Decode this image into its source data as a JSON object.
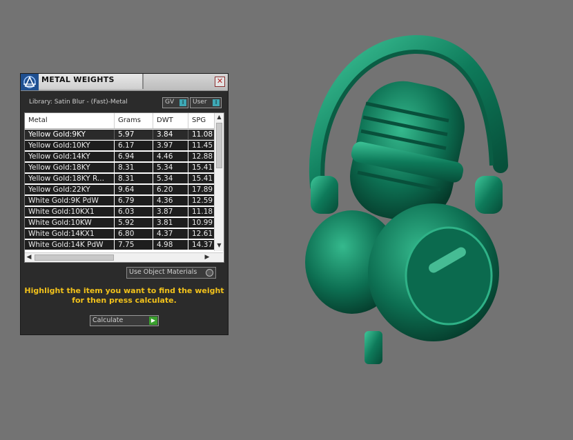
{
  "panel": {
    "title": "METAL WEIGHTS",
    "library": "Library: Satin Blur - (Fast)-Metal",
    "toggle_gv": "GV",
    "toggle_user": "User",
    "table": {
      "headers": [
        "Metal",
        "Grams",
        "DWT",
        "SPG"
      ],
      "rows": [
        [
          "Yellow Gold:9KY",
          "5.97",
          "3.84",
          "11.08"
        ],
        [
          "Yellow Gold:10KY",
          "6.17",
          "3.97",
          "11.45"
        ],
        [
          "Yellow Gold:14KY",
          "6.94",
          "4.46",
          "12.88"
        ],
        [
          "Yellow Gold:18KY",
          "8.31",
          "5.34",
          "15.41"
        ],
        [
          "Yellow Gold:18KY R...",
          "8.31",
          "5.34",
          "15.41"
        ],
        [
          "Yellow Gold:22KY",
          "9.64",
          "6.20",
          "17.89"
        ],
        [
          "White Gold:9K PdW",
          "6.79",
          "4.36",
          "12.59"
        ],
        [
          "White Gold:10KX1",
          "6.03",
          "3.87",
          "11.18"
        ],
        [
          "White Gold:10KW",
          "5.92",
          "3.81",
          "10.99"
        ],
        [
          "White Gold:14KX1",
          "6.80",
          "4.37",
          "12.61"
        ],
        [
          "White Gold:14K PdW",
          "7.75",
          "4.98",
          "14.37"
        ]
      ]
    },
    "use_object_materials": "Use Object Materials",
    "hint": "Highlight the item you want to find the weight for then press calculate.",
    "calculate": "Calculate"
  },
  "colors": {
    "background": "#737373",
    "panel": "#2b2b2b",
    "hint": "#f2c21b",
    "toggle_knob": "#3ea8b5",
    "calculate_arrow": "#3aa02e",
    "model": "#0e7a5a"
  },
  "icons": [
    "app-logo-icon",
    "close-icon",
    "scroll-up-icon",
    "scroll-down-icon",
    "scroll-left-icon",
    "scroll-right-icon",
    "play-arrow-icon"
  ]
}
